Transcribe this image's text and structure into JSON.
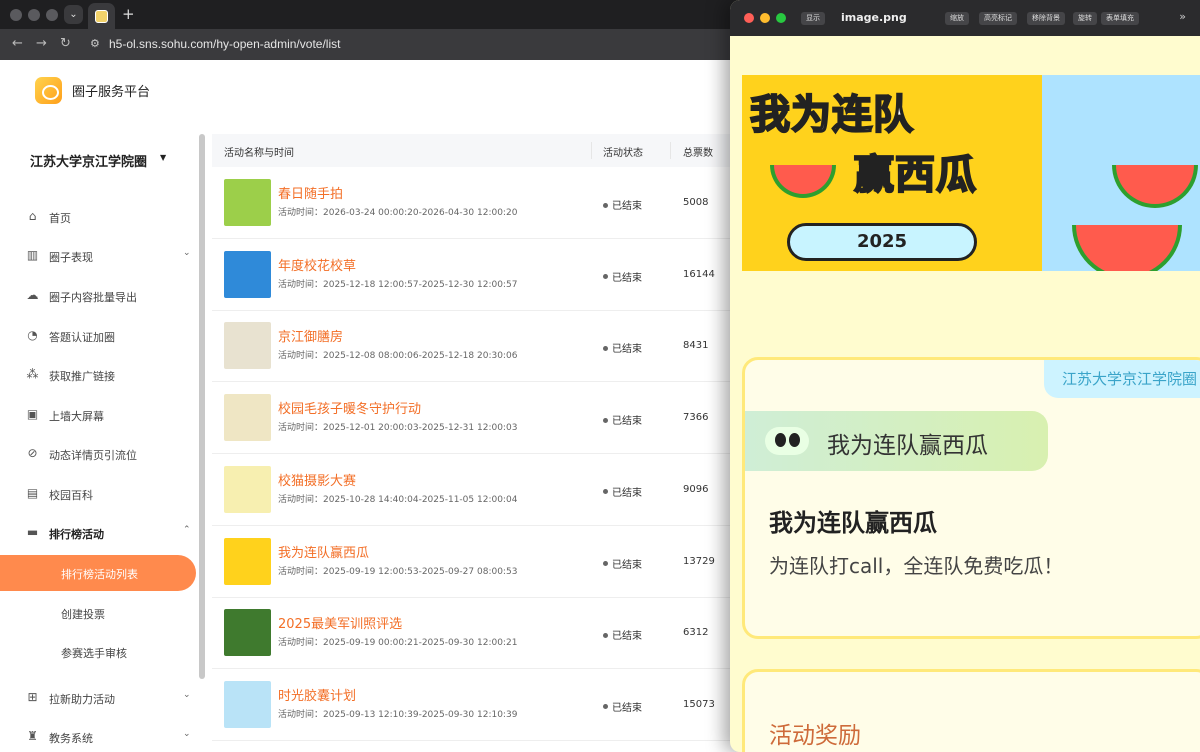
{
  "browser": {
    "url": "h5-ol.sns.sohu.com/hy-open-admin/vote/list"
  },
  "app": {
    "brand": "圈子服务平台",
    "circle_name": "江苏大学京江学院圈"
  },
  "sidebar": {
    "items": [
      {
        "label": "首页",
        "icon": "home-icon"
      },
      {
        "label": "圈子表现",
        "icon": "bar-chart-icon",
        "expandable": true
      },
      {
        "label": "圈子内容批量导出",
        "icon": "cloud-download-icon"
      },
      {
        "label": "答题认证加圈",
        "icon": "user-check-icon"
      },
      {
        "label": "获取推广链接",
        "icon": "share-icon"
      },
      {
        "label": "上墙大屏幕",
        "icon": "screen-icon"
      },
      {
        "label": "动态详情页引流位",
        "icon": "link-icon"
      },
      {
        "label": "校园百科",
        "icon": "book-icon"
      },
      {
        "label": "排行榜活动",
        "icon": "ranking-icon",
        "expanded": true
      }
    ],
    "sub_items": [
      {
        "label": "排行榜活动列表",
        "active": true
      },
      {
        "label": "创建投票"
      },
      {
        "label": "参赛选手审核"
      }
    ],
    "bottom_items": [
      {
        "label": "拉新助力活动",
        "icon": "gift-icon",
        "expandable": true
      },
      {
        "label": "教务系统",
        "icon": "graduation-cap-icon",
        "expandable": true
      }
    ]
  },
  "table": {
    "headers": {
      "name": "活动名称与时间",
      "status": "活动状态",
      "votes": "总票数"
    },
    "rows": [
      {
        "title": "春日随手拍",
        "time": "活动时间：2026-03-24 00:00:20-2026-04-30 12:00:20",
        "status": "已结束",
        "votes": "5008",
        "thumb": "#9ccf4a"
      },
      {
        "title": "年度校花校草",
        "time": "活动时间：2025-12-18 12:00:57-2025-12-30 12:00:57",
        "status": "已结束",
        "votes": "16144",
        "thumb": "#2f8ad9"
      },
      {
        "title": "京江御膳房",
        "time": "活动时间：2025-12-08 08:00:06-2025-12-18 20:30:06",
        "status": "已结束",
        "votes": "8431",
        "thumb": "#e8e2d0"
      },
      {
        "title": "校园毛孩子暖冬守护行动",
        "time": "活动时间：2025-12-01 20:00:03-2025-12-31 12:00:03",
        "status": "已结束",
        "votes": "7366",
        "thumb": "#efe6c4"
      },
      {
        "title": "校猫摄影大赛",
        "time": "活动时间：2025-10-28 14:40:04-2025-11-05 12:00:04",
        "status": "已结束",
        "votes": "9096",
        "thumb": "#f7efb0"
      },
      {
        "title": "我为连队赢西瓜",
        "time": "活动时间：2025-09-19 12:00:53-2025-09-27 08:00:53",
        "status": "已结束",
        "votes": "13729",
        "thumb": "#ffd21c"
      },
      {
        "title": "2025最美军训照评选",
        "time": "活动时间：2025-09-19 00:00:21-2025-09-30 12:00:21",
        "status": "已结束",
        "votes": "6312",
        "thumb": "#3f7a2e"
      },
      {
        "title": "时光胶囊计划",
        "time": "活动时间：2025-09-13 12:10:39-2025-09-30 12:10:39",
        "status": "已结束",
        "votes": "15073",
        "thumb": "#b9e3f7"
      }
    ]
  },
  "viewer": {
    "toolbar_left": "显示",
    "title": "image.png",
    "toolbar_buttons": [
      "缩放",
      "高亮标记",
      "移除背景",
      "旋转",
      "表单填充"
    ],
    "banner": {
      "title_line1": "我为连队",
      "title_line2": "赢西瓜",
      "year": "2025"
    },
    "card": {
      "tag": "江苏大学京江学院圈",
      "chip_label": "我为连队赢西瓜",
      "title": "我为连队赢西瓜",
      "subtitle": "为连队打call，全连队免费吃瓜！"
    },
    "card2": {
      "title": "活动奖励"
    }
  }
}
